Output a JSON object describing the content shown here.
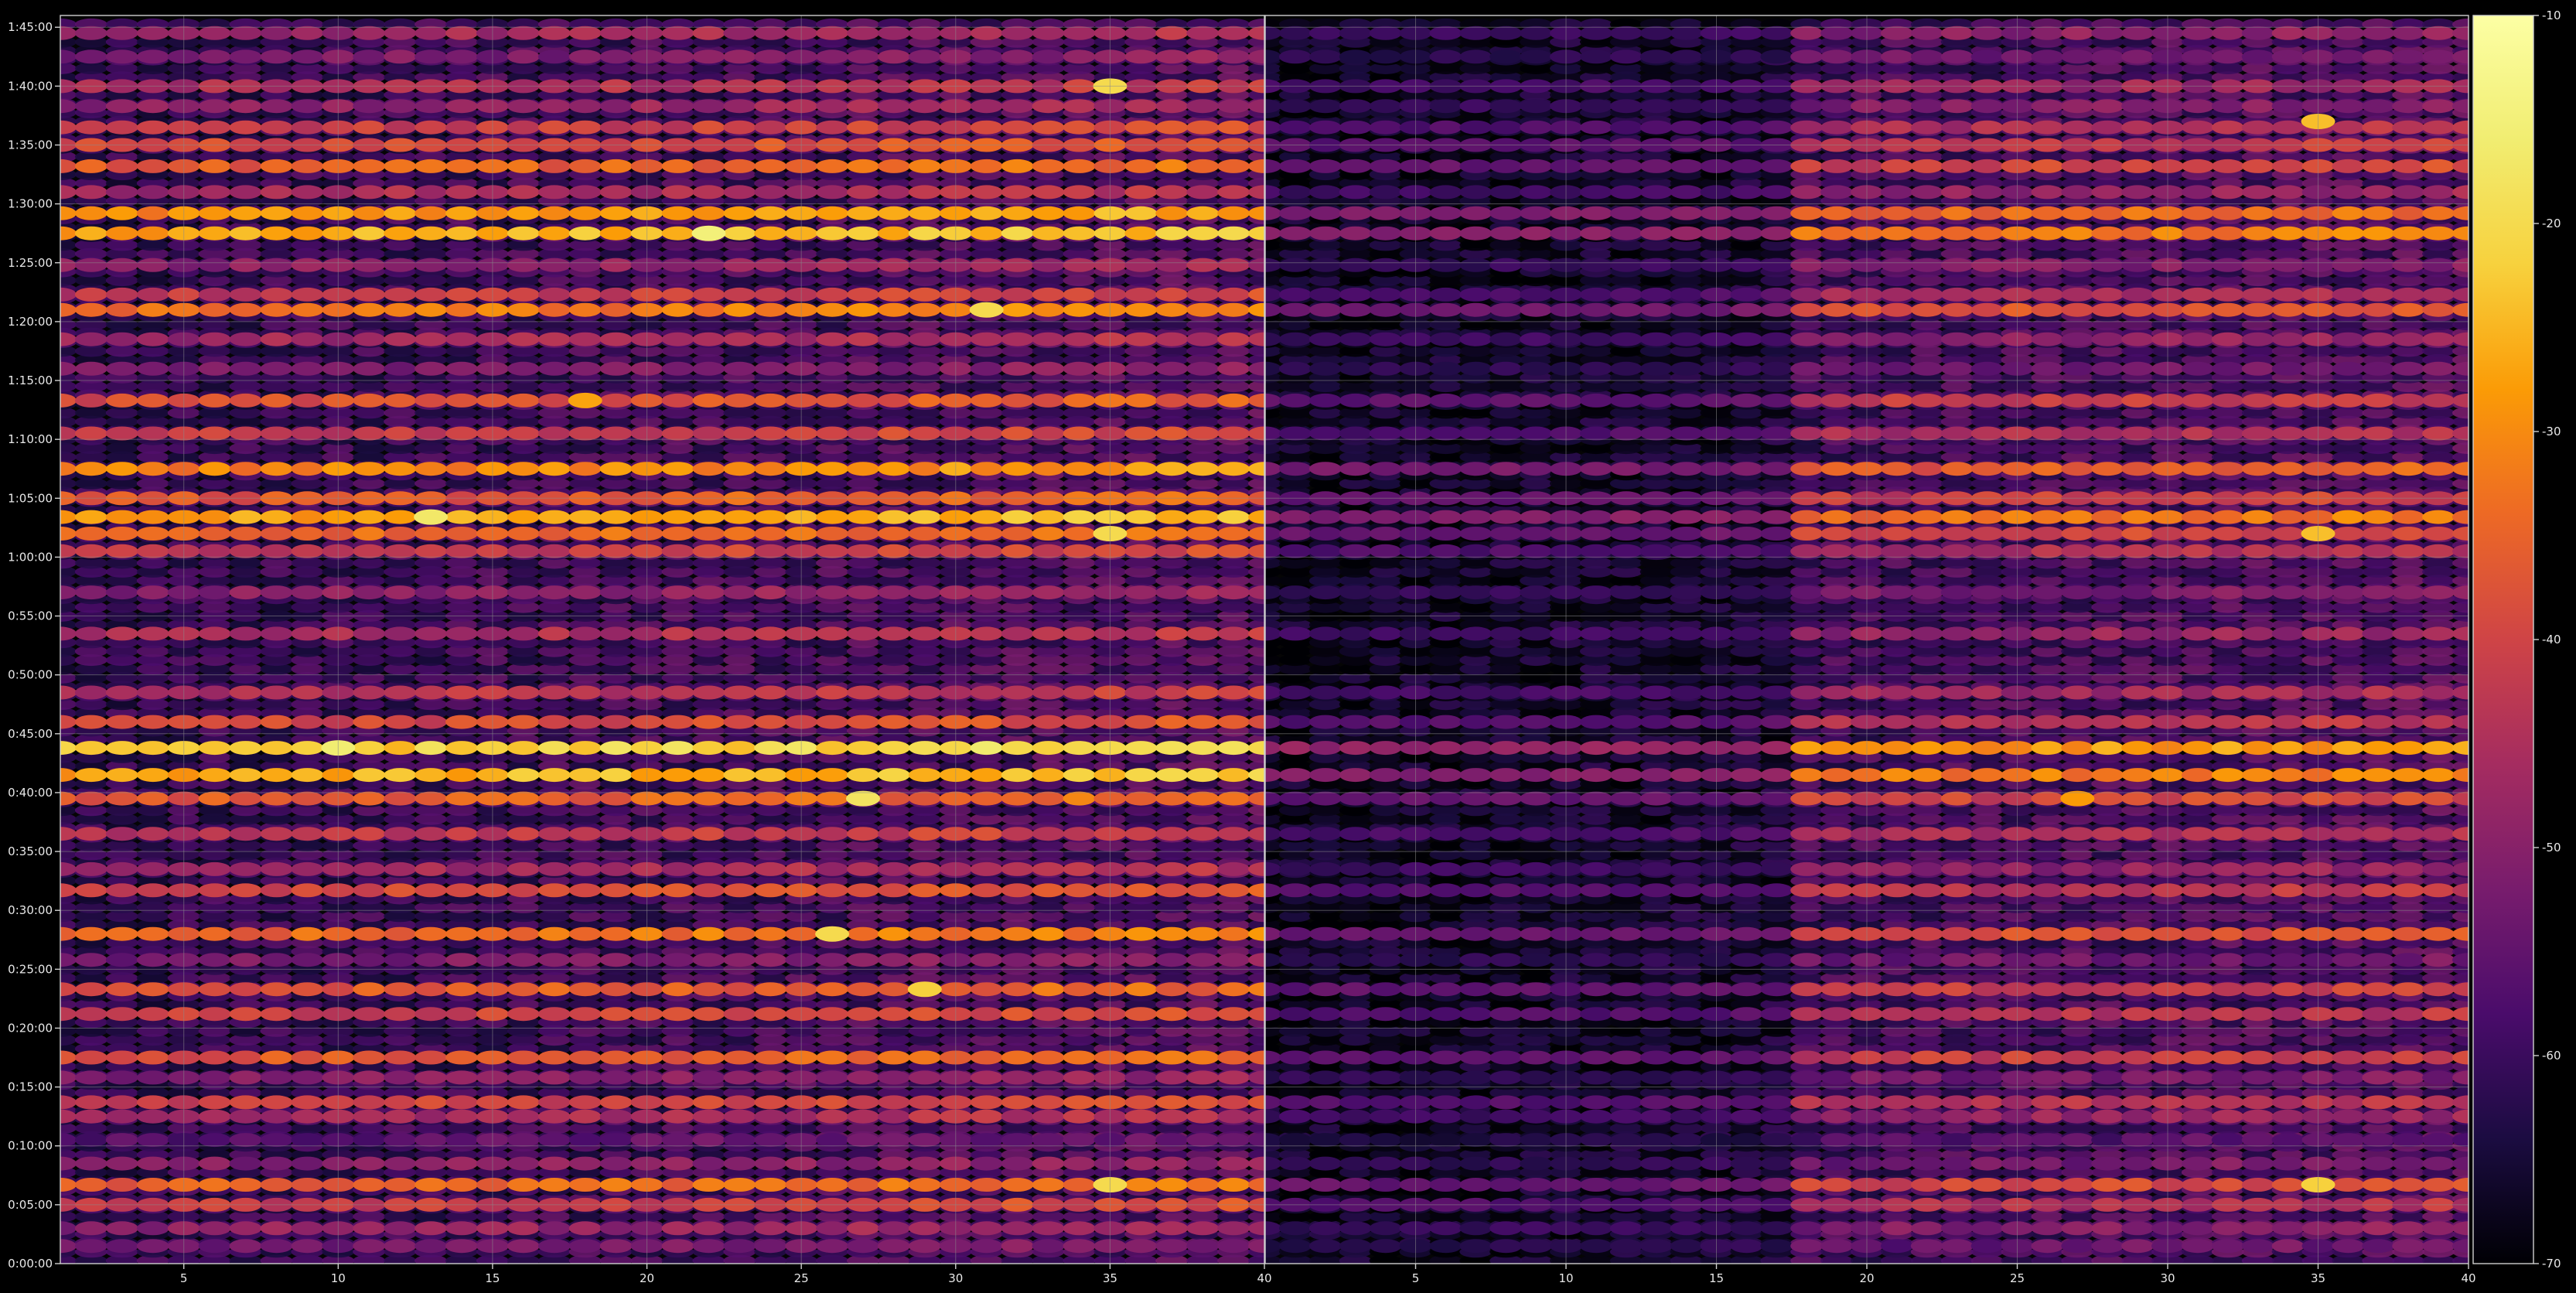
{
  "chart_data": {
    "type": "heatmap",
    "title": "",
    "xlabel": "",
    "ylabel": "",
    "colormap": "inferno",
    "background": "#000000",
    "grid": true,
    "legend": "colorbar-right",
    "panels": [
      {
        "name": "",
        "xlim": [
          1,
          40
        ],
        "x_ticks": [
          5,
          10,
          15,
          20,
          25,
          30,
          35,
          40
        ],
        "band_intensity_scale": 1.0
      },
      {
        "name": "",
        "xlim": [
          0,
          40
        ],
        "x_ticks": [
          5,
          10,
          15,
          20,
          25,
          30,
          35,
          40
        ],
        "band_intensity_scale": 0.82,
        "columns_1_to_17_scale": 0.55
      }
    ],
    "y_axis": {
      "unit": "minutes",
      "ylim": [
        0,
        106
      ],
      "ticks": [
        {
          "value": 0,
          "label": "0:00:00"
        },
        {
          "value": 5,
          "label": "0:05:00"
        },
        {
          "value": 10,
          "label": "0:10:00"
        },
        {
          "value": 15,
          "label": "0:15:00"
        },
        {
          "value": 20,
          "label": "0:20:00"
        },
        {
          "value": 25,
          "label": "0:25:00"
        },
        {
          "value": 30,
          "label": "0:30:00"
        },
        {
          "value": 35,
          "label": "0:35:00"
        },
        {
          "value": 40,
          "label": "0:40:00"
        },
        {
          "value": 45,
          "label": "0:45:00"
        },
        {
          "value": 50,
          "label": "0:50:00"
        },
        {
          "value": 55,
          "label": "0:55:00"
        },
        {
          "value": 60,
          "label": "1:00:00"
        },
        {
          "value": 65,
          "label": "1:05:00"
        },
        {
          "value": 70,
          "label": "1:10:00"
        },
        {
          "value": 75,
          "label": "1:15:00"
        },
        {
          "value": 80,
          "label": "1:20:00"
        },
        {
          "value": 85,
          "label": "1:25:00"
        },
        {
          "value": 90,
          "label": "1:30:00"
        },
        {
          "value": 95,
          "label": "1:35:00"
        },
        {
          "value": 100,
          "label": "1:40:00"
        },
        {
          "value": 105,
          "label": "1:45:00"
        }
      ]
    },
    "colorbar": {
      "range": [
        -70,
        -10
      ],
      "ticks": [
        -10,
        -20,
        -30,
        -40,
        -50,
        -60,
        -70
      ]
    },
    "bands": [
      {
        "time": 1.5,
        "value": -54
      },
      {
        "time": 3.0,
        "value": -50
      },
      {
        "time": 5.0,
        "value": -42
      },
      {
        "time": 6.7,
        "value": -36
      },
      {
        "time": 8.5,
        "value": -52
      },
      {
        "time": 10.5,
        "value": -57
      },
      {
        "time": 12.5,
        "value": -47
      },
      {
        "time": 13.7,
        "value": -42
      },
      {
        "time": 15.8,
        "value": -52
      },
      {
        "time": 17.5,
        "value": -38
      },
      {
        "time": 21.2,
        "value": -42
      },
      {
        "time": 23.3,
        "value": -38
      },
      {
        "time": 25.8,
        "value": -53
      },
      {
        "time": 28.0,
        "value": -35
      },
      {
        "time": 31.7,
        "value": -41
      },
      {
        "time": 33.5,
        "value": -48
      },
      {
        "time": 36.5,
        "value": -44
      },
      {
        "time": 39.5,
        "value": -37
      },
      {
        "time": 41.5,
        "value": -27
      },
      {
        "time": 43.8,
        "value": -23
      },
      {
        "time": 46.0,
        "value": -41
      },
      {
        "time": 48.5,
        "value": -45
      },
      {
        "time": 53.5,
        "value": -47
      },
      {
        "time": 57.0,
        "value": -51
      },
      {
        "time": 60.5,
        "value": -43
      },
      {
        "time": 62.0,
        "value": -36
      },
      {
        "time": 63.4,
        "value": -28
      },
      {
        "time": 65.0,
        "value": -38
      },
      {
        "time": 67.5,
        "value": -32
      },
      {
        "time": 70.5,
        "value": -43
      },
      {
        "time": 73.3,
        "value": -39
      },
      {
        "time": 76.0,
        "value": -53
      },
      {
        "time": 78.5,
        "value": -48
      },
      {
        "time": 81.0,
        "value": -34
      },
      {
        "time": 82.3,
        "value": -43
      },
      {
        "time": 84.8,
        "value": -50
      },
      {
        "time": 87.5,
        "value": -27
      },
      {
        "time": 89.2,
        "value": -30
      },
      {
        "time": 91.0,
        "value": -47
      },
      {
        "time": 93.2,
        "value": -37
      },
      {
        "time": 95.0,
        "value": -40
      },
      {
        "time": 96.5,
        "value": -43
      },
      {
        "time": 98.3,
        "value": -50
      },
      {
        "time": 100.0,
        "value": -46
      },
      {
        "time": 102.5,
        "value": -53
      },
      {
        "time": 104.5,
        "value": -48
      }
    ],
    "hotspots": [
      {
        "panel": 0,
        "x": 10,
        "time": 43.8,
        "value": -16
      },
      {
        "panel": 0,
        "x": 13,
        "time": 63.4,
        "value": -17
      },
      {
        "panel": 0,
        "x": 22,
        "time": 87.5,
        "value": -15
      },
      {
        "panel": 0,
        "x": 27,
        "time": 39.5,
        "value": -18
      },
      {
        "panel": 0,
        "x": 26,
        "time": 28.0,
        "value": -20
      },
      {
        "panel": 0,
        "x": 29,
        "time": 23.3,
        "value": -22
      },
      {
        "panel": 0,
        "x": 31,
        "time": 81.0,
        "value": -20
      },
      {
        "panel": 0,
        "x": 35,
        "time": 6.7,
        "value": -20
      },
      {
        "panel": 0,
        "x": 35,
        "time": 62.0,
        "value": -20
      },
      {
        "panel": 0,
        "x": 35,
        "time": 100.0,
        "value": -20
      },
      {
        "panel": 0,
        "x": 18,
        "time": 73.3,
        "value": -27
      },
      {
        "panel": 1,
        "x": 27,
        "time": 39.5,
        "value": -28
      },
      {
        "panel": 1,
        "x": 35,
        "time": 6.7,
        "value": -22
      },
      {
        "panel": 1,
        "x": 35,
        "time": 62.0,
        "value": -24
      },
      {
        "panel": 1,
        "x": 35,
        "time": 97.0,
        "value": -24
      }
    ]
  }
}
